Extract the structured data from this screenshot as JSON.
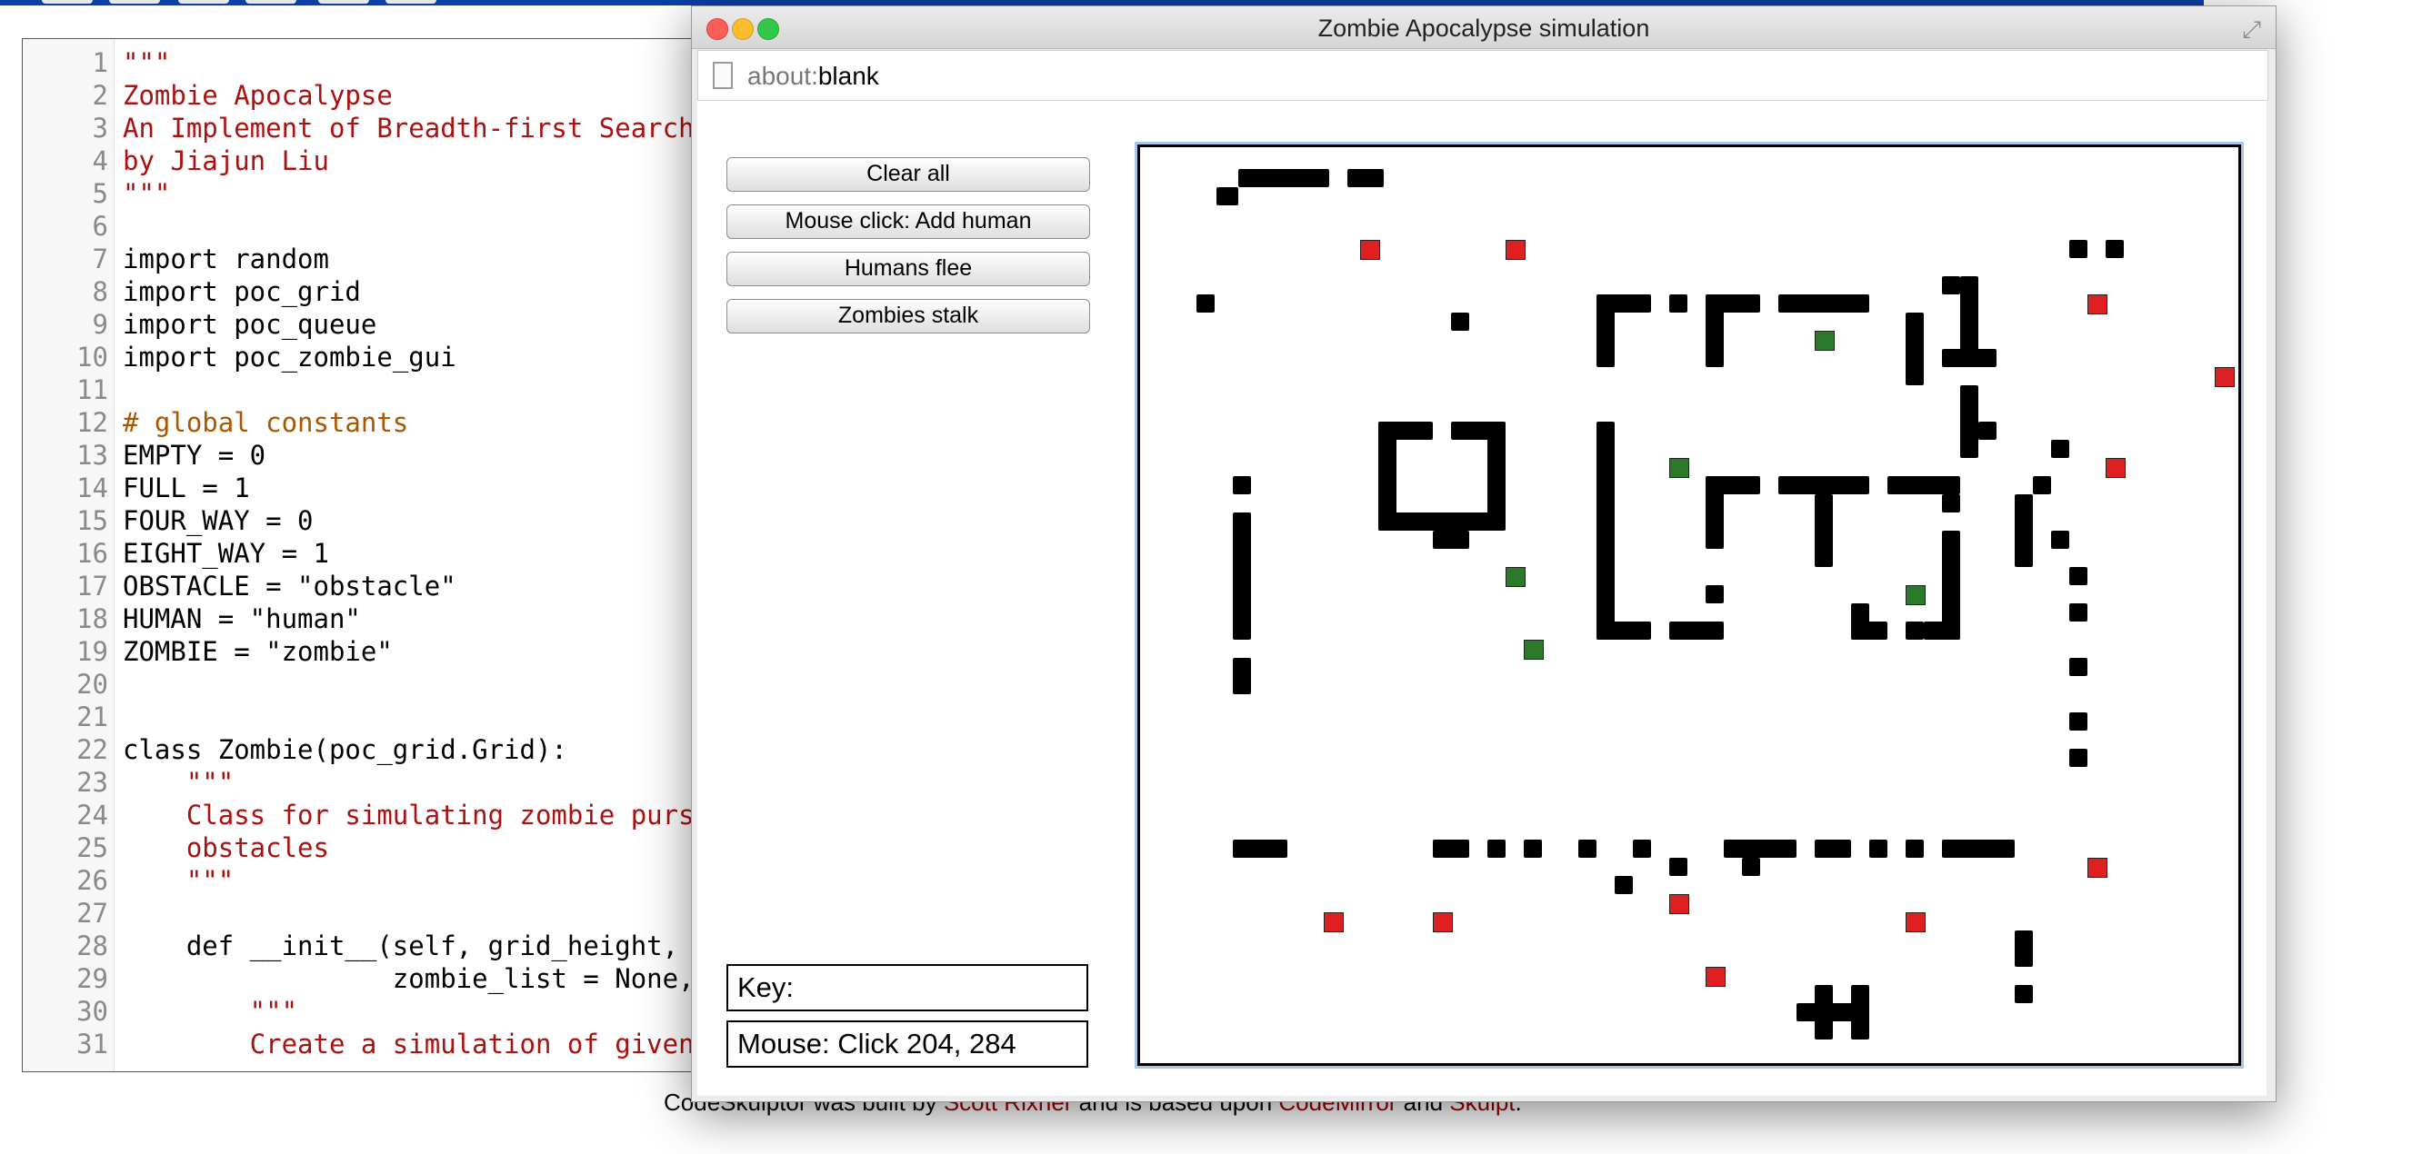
{
  "window": {
    "title": "Zombie Apocalypse simulation",
    "address_scheme": "about:",
    "address_host": "blank"
  },
  "controls": {
    "buttons": [
      "Clear all",
      "Mouse click: Add human",
      "Humans flee",
      "Zombies stalk"
    ],
    "key_label": "Key:",
    "mouse_label": "Mouse: Click 204, 284"
  },
  "colors": {
    "zombie": "#2a7a2a",
    "human": "#e02020",
    "obstacle": "#000000",
    "window_bg": "#ececec"
  },
  "editor": {
    "line_numbers": [
      "1",
      "2",
      "3",
      "4",
      "5",
      "6",
      "7",
      "8",
      "9",
      "10",
      "11",
      "12",
      "13",
      "14",
      "15",
      "16",
      "17",
      "18",
      "19",
      "20",
      "21",
      "22",
      "23",
      "24",
      "25",
      "26",
      "27",
      "28",
      "29",
      "30",
      "31"
    ],
    "lines": [
      "\"\"\"",
      "Zombie Apocalypse",
      "An Implement of Breadth-first Search",
      "by Jiajun Liu",
      "\"\"\"",
      "",
      "import random",
      "import poc_grid",
      "import poc_queue",
      "import poc_zombie_gui",
      "",
      "# global constants",
      "EMPTY = 0",
      "FULL = 1",
      "FOUR_WAY = 0",
      "EIGHT_WAY = 1",
      "OBSTACLE = \"obstacle\"",
      "HUMAN = \"human\"",
      "ZOMBIE = \"zombie\"",
      "",
      "",
      "class Zombie(poc_grid.Grid):",
      "    \"\"\"",
      "    Class for simulating zombie pursuit of human on grid with",
      "    obstacles",
      "    \"\"\"",
      "",
      "    def __init__(self, grid_height, grid_width, obstacle_list = None,",
      "                 zombie_list = None, human_list = None):",
      "        \"\"\"",
      "        Create a simulation of given size with given obstacles,"
    ]
  },
  "footer": {
    "prefix": "CodeSkulptor was built by ",
    "author": "Scott Rixner",
    "middle": " and is based upon ",
    "lib1": "CodeMirror",
    "and": " and ",
    "lib2": "Skulpt",
    "suffix": "."
  }
}
